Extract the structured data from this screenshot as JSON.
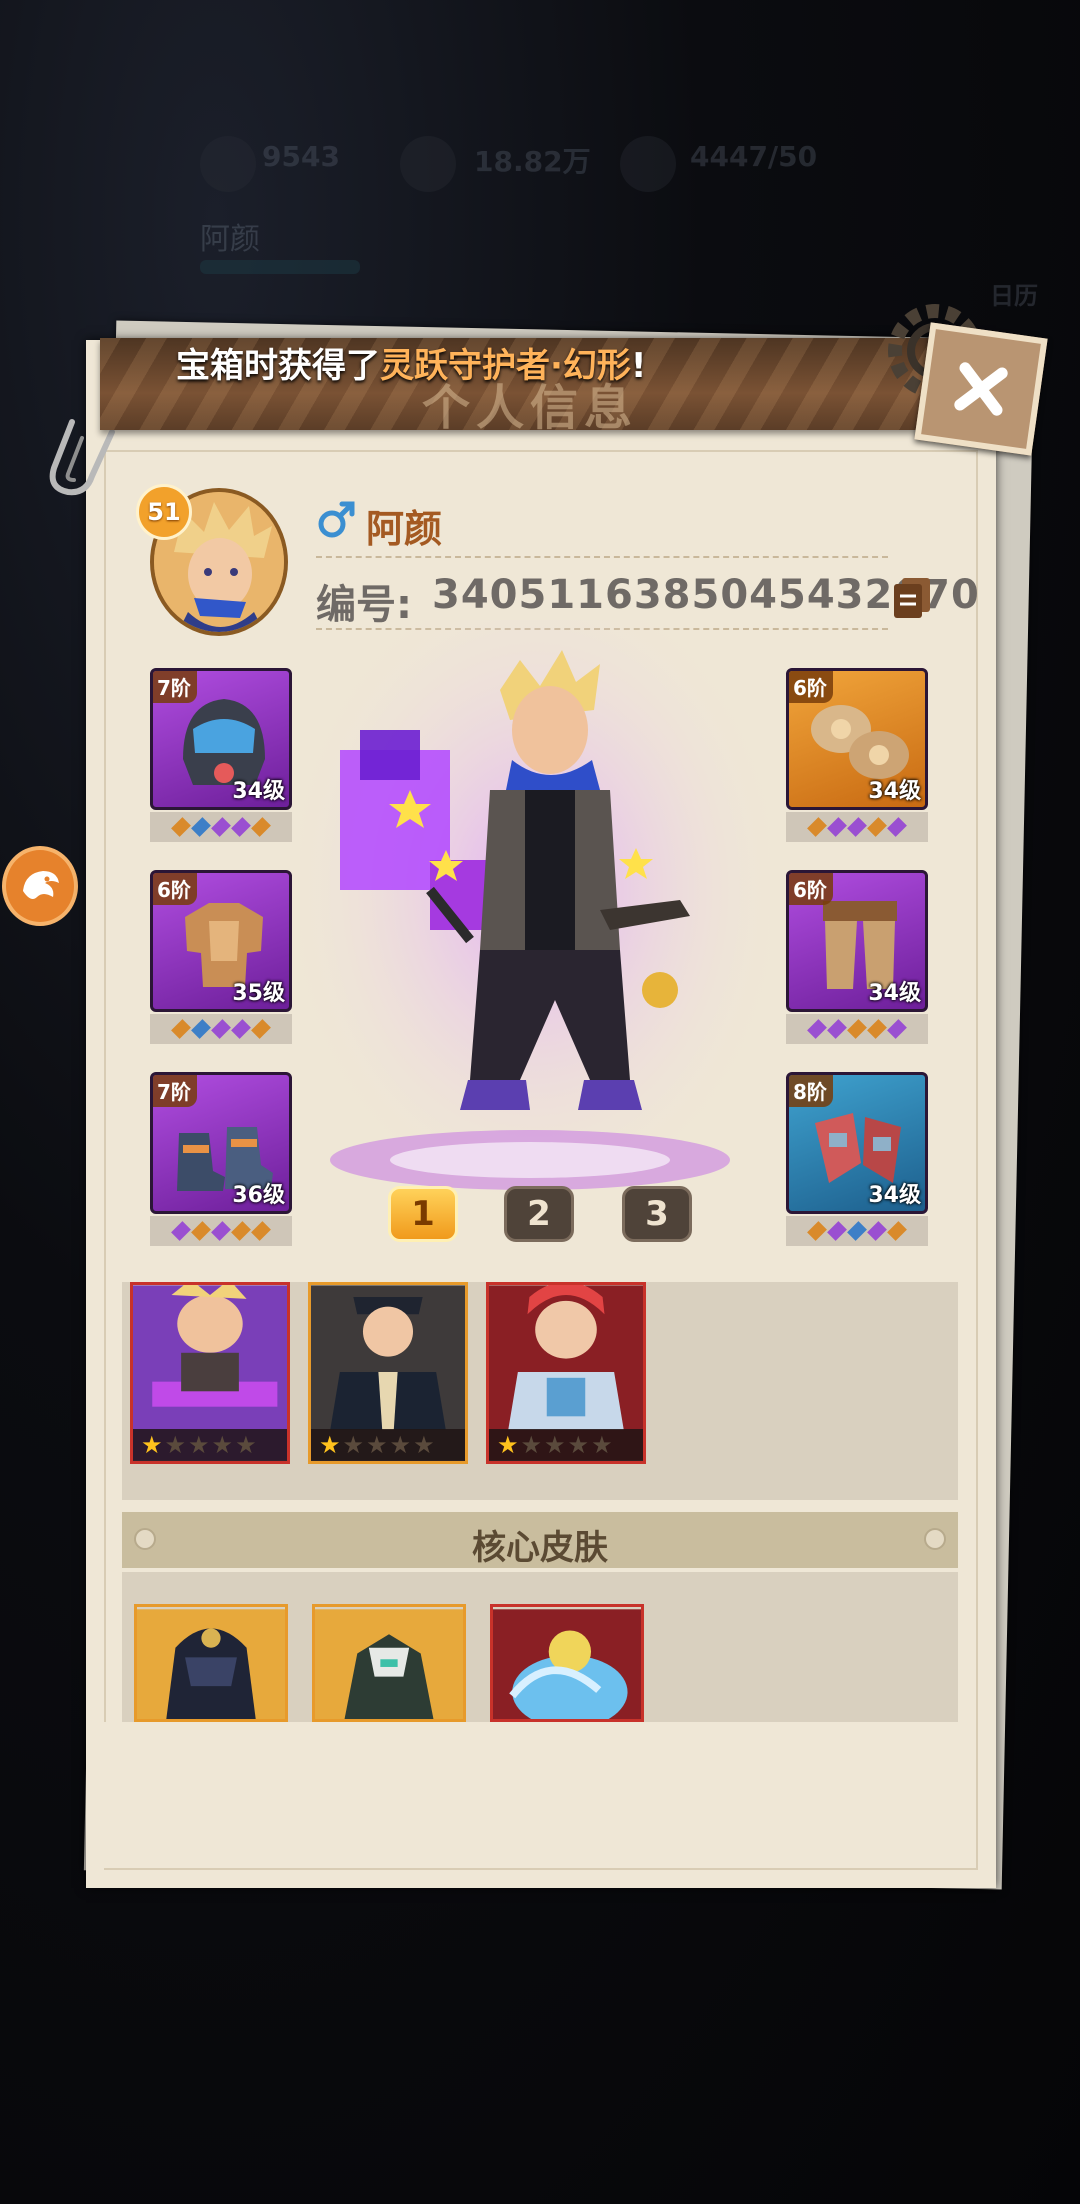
{
  "background_hud": {
    "res1": "9543",
    "res2": "18.82万",
    "res3": "4447/50",
    "name": "阿颜",
    "right_label": "日历"
  },
  "notice": {
    "prefix": "宝箱时获得了",
    "highlight": "灵跃守护者·幻形",
    "suffix": "!"
  },
  "dialog": {
    "title": "个人信息"
  },
  "profile": {
    "level": "51",
    "name": "阿颜",
    "id_label": "编号:",
    "id_value": "340511638504543267​0"
  },
  "equipment_left": [
    {
      "tier": "7阶",
      "level": "34级",
      "rarity": "purple",
      "icon": "helmet-icon",
      "gems": [
        "o",
        "b",
        "p",
        "p",
        "o"
      ]
    },
    {
      "tier": "6阶",
      "level": "35级",
      "rarity": "purple",
      "icon": "chest-armor-icon",
      "gems": [
        "o",
        "b",
        "p",
        "p",
        "o"
      ]
    },
    {
      "tier": "7阶",
      "level": "36级",
      "rarity": "purple",
      "icon": "boots-icon",
      "gems": [
        "p",
        "o",
        "p",
        "o",
        "o"
      ]
    }
  ],
  "equipment_right": [
    {
      "tier": "6阶",
      "level": "34级",
      "rarity": "orange",
      "icon": "shoulder-armor-icon",
      "gems": [
        "o",
        "p",
        "p",
        "o",
        "p"
      ]
    },
    {
      "tier": "6阶",
      "level": "34级",
      "rarity": "purple",
      "icon": "leg-armor-icon",
      "gems": [
        "p",
        "p",
        "o",
        "o",
        "p"
      ]
    },
    {
      "tier": "8阶",
      "level": "34级",
      "rarity": "blue",
      "icon": "gauntlets-icon",
      "gems": [
        "o",
        "p",
        "b",
        "p",
        "o"
      ]
    }
  ],
  "pages": [
    "1",
    "2",
    "3"
  ],
  "active_page": 1,
  "heroes": [
    {
      "frame": "#c8322a",
      "stars": 1,
      "theme": "purple-gunner"
    },
    {
      "frame": "#e79a2b",
      "stars": 1,
      "theme": "officer"
    },
    {
      "frame": "#c8322a",
      "stars": 1,
      "theme": "red-hair"
    }
  ],
  "core_skin": {
    "title": "核心皮肤",
    "skins": [
      {
        "frame": "#e79a2b",
        "theme": "dark-knight"
      },
      {
        "frame": "#e79a2b",
        "theme": "mecha"
      },
      {
        "frame": "#c8322a",
        "theme": "water-dragon"
      }
    ]
  },
  "colors": {
    "paper": "#efe7d6",
    "banner": "#6b4a30",
    "highlight": "#ffb35a",
    "name": "#a45a22"
  }
}
